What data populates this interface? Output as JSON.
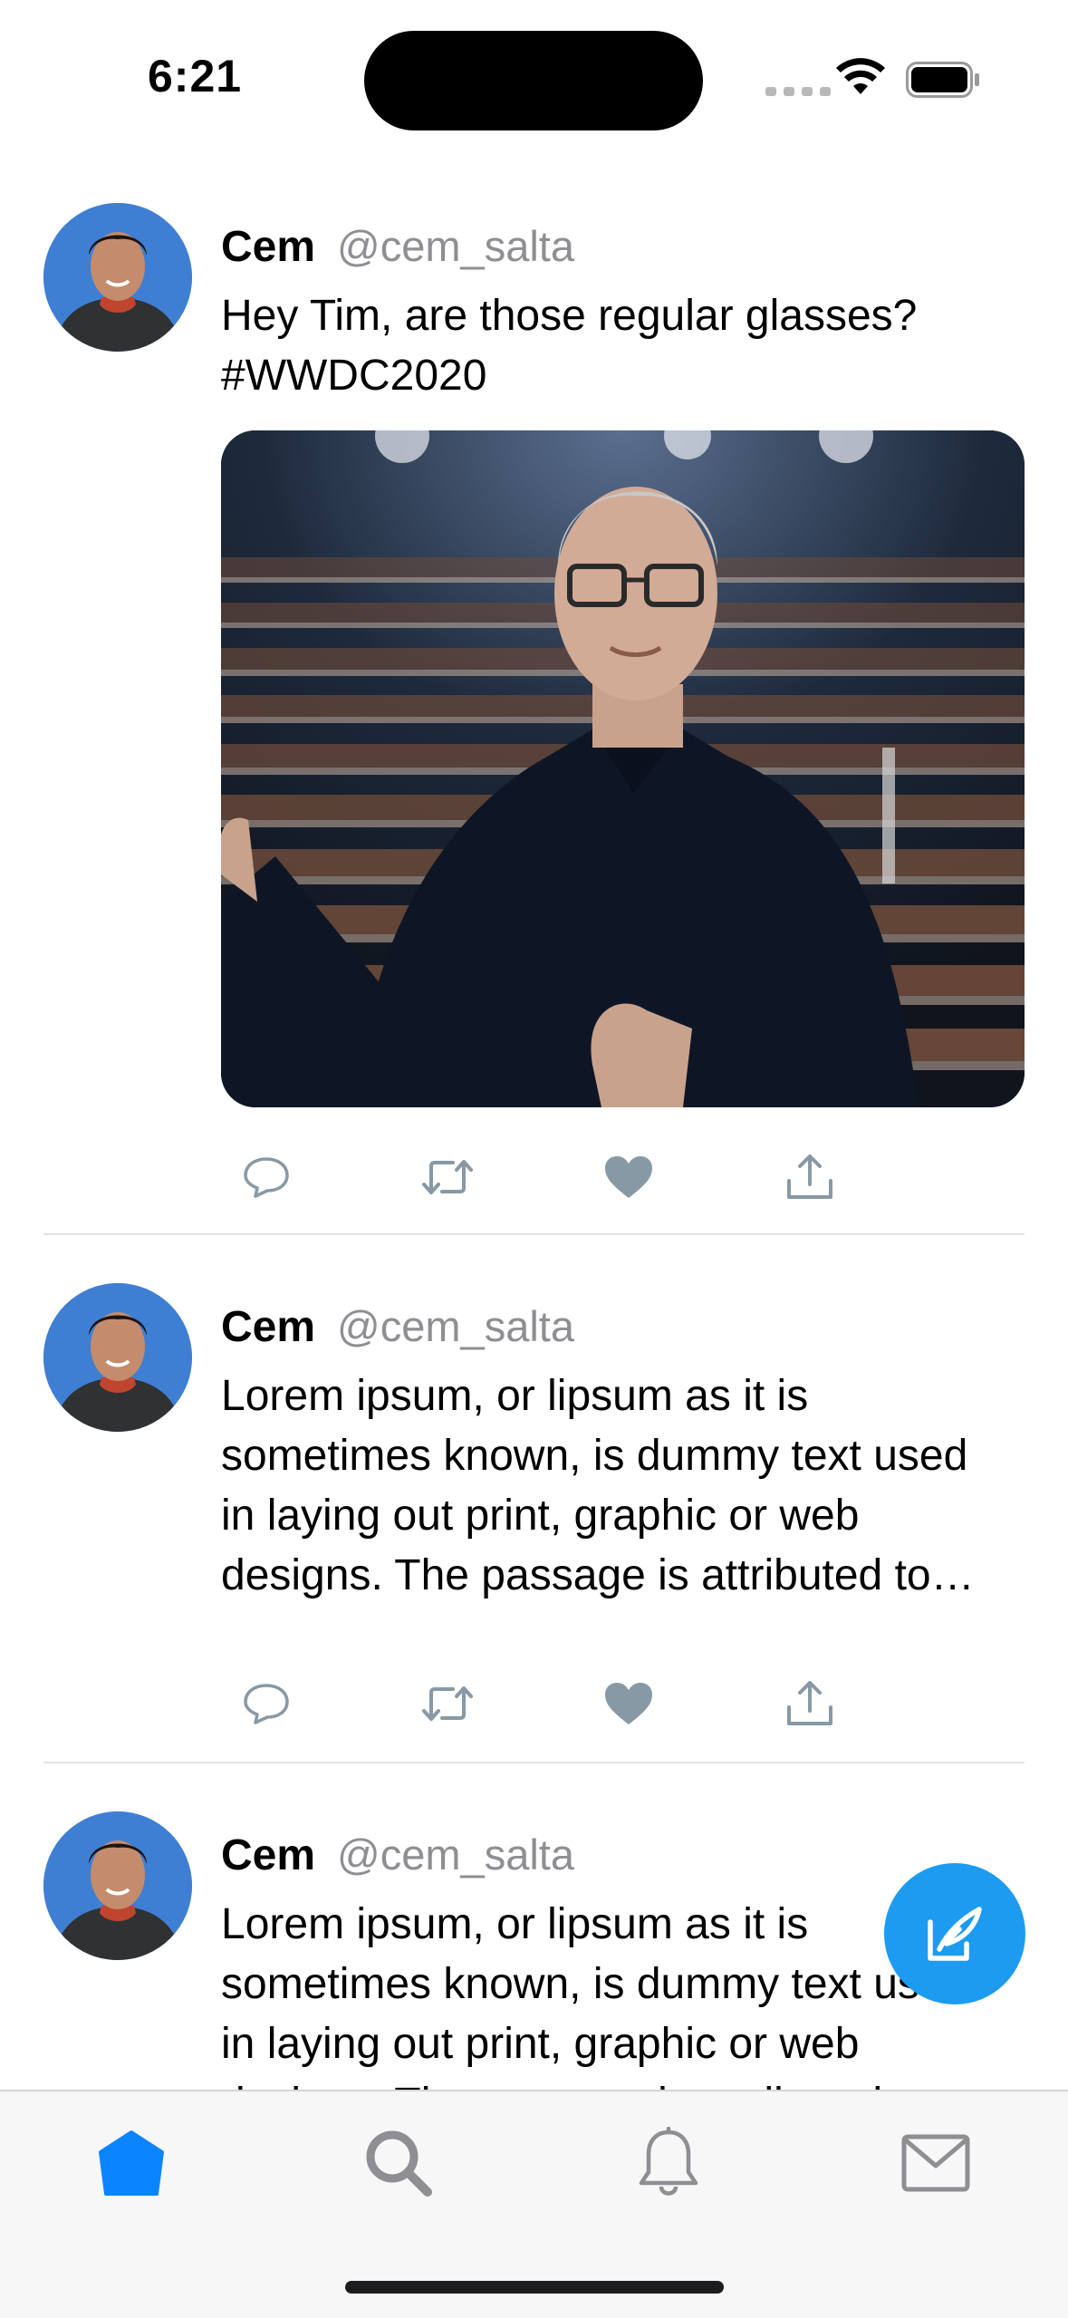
{
  "status_bar": {
    "time": "6:21"
  },
  "tweets": [
    {
      "name": "Cem",
      "handle": "@cem_salta",
      "text_lines": [
        "Hey Tim, are those regular glasses?",
        "#WWDC2020"
      ],
      "has_image": true
    },
    {
      "name": "Cem",
      "handle": "@cem_salta",
      "text_lines": [
        "Lorem ipsum, or lipsum as it is",
        "sometimes known, is dummy text used",
        "in laying out print, graphic or web",
        "designs. The passage is attributed to…"
      ],
      "has_image": false
    },
    {
      "name": "Cem",
      "handle": "@cem_salta",
      "text_lines": [
        "Lorem ipsum, or lipsum as it is",
        "sometimes known, is dummy text used",
        "in laying out print, graphic or web",
        "designs. The passage is attributed to…"
      ],
      "has_image": false
    }
  ],
  "action_icons": [
    "reply-icon",
    "retweet-icon",
    "like-icon",
    "share-icon"
  ],
  "tabbar": {
    "items": [
      {
        "icon": "home-icon",
        "active": true
      },
      {
        "icon": "search-icon",
        "active": false
      },
      {
        "icon": "bell-icon",
        "active": false
      },
      {
        "icon": "mail-icon",
        "active": false
      }
    ]
  },
  "colors": {
    "accent": "#1d9bf0",
    "tab_active": "#0a84ff",
    "action_gray": "#8899a6",
    "handle_gray": "#8e8e93"
  }
}
